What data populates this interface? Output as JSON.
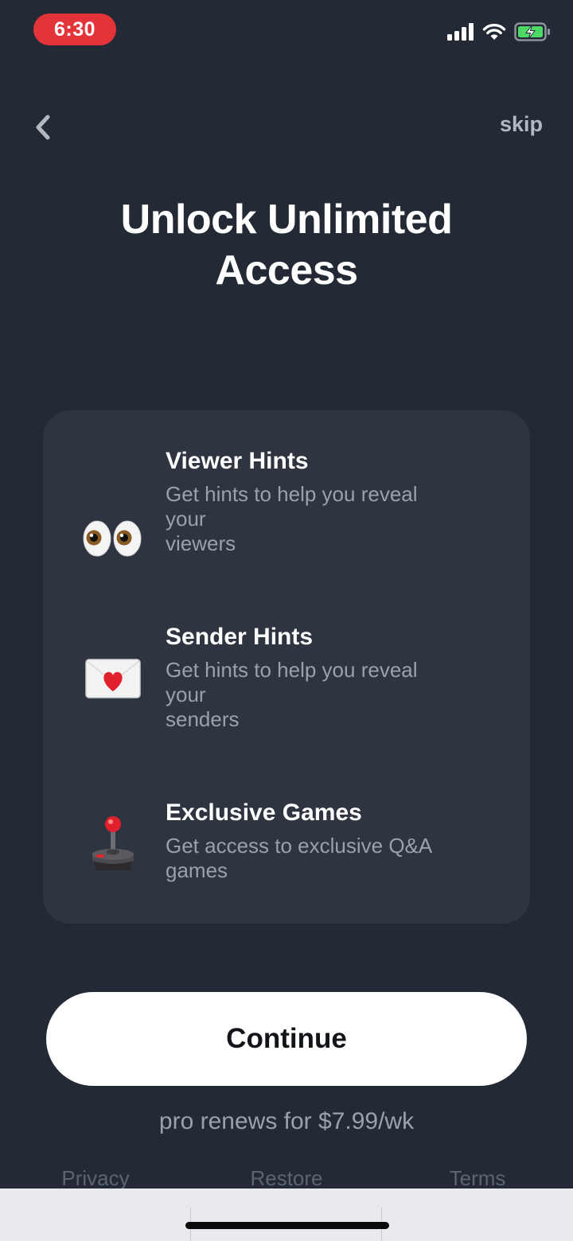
{
  "status_bar": {
    "time": "6:30",
    "signal_icon": "cellular-signal-icon",
    "wifi_icon": "wifi-icon",
    "battery_icon": "battery-charging-icon",
    "time_pill_color": "#e3343a",
    "battery_color": "#4cd964"
  },
  "nav": {
    "back_icon": "chevron-left-icon",
    "skip_label": "skip"
  },
  "title": {
    "line1": "Unlock Unlimited",
    "line2": "Access"
  },
  "features": [
    {
      "icon": "eyes-icon",
      "title": "Viewer Hints",
      "description": "Get hints to help you reveal\nyour\nviewers"
    },
    {
      "icon": "love-letter-icon",
      "title": "Sender Hints",
      "description": "Get hints to help you reveal\nyour\nsenders"
    },
    {
      "icon": "joystick-icon",
      "title": "Exclusive Games",
      "description": "Get access to exclusive Q&A\ngames"
    }
  ],
  "cta": {
    "continue_label": "Continue",
    "renew_text": "pro renews for $7.99/wk"
  },
  "footer": {
    "privacy_label": "Privacy",
    "restore_label": "Restore",
    "terms_label": "Terms"
  },
  "colors": {
    "background": "#232a35",
    "card": "#2e3440",
    "muted_text": "#9aa1ac"
  }
}
